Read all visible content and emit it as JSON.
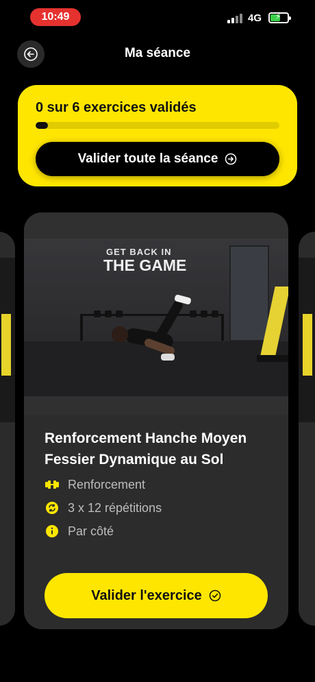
{
  "status_bar": {
    "time": "10:49",
    "network": "4G",
    "battery_level": 0.6
  },
  "header": {
    "title": "Ma séance",
    "back_icon": "back-arrow-circle-icon"
  },
  "progress": {
    "text": "0 sur 6 exercices validés",
    "completed": 0,
    "total": 6,
    "bar_fill_fraction": 0.05,
    "button_label": "Valider toute la séance"
  },
  "exercise": {
    "video_logo_top": "GET BACK IN",
    "video_logo_bottom": "THE GAME",
    "title": "Renforcement Hanche Moyen Fessier Dynamique au Sol",
    "category": "Renforcement",
    "reps": "3 x 12 répétitions",
    "note": "Par côté",
    "button_label": "Valider l'exercice"
  },
  "colors": {
    "accent": "#ffe600",
    "background": "#000000",
    "card": "#2c2c2c",
    "time_pill": "#e5322f"
  }
}
